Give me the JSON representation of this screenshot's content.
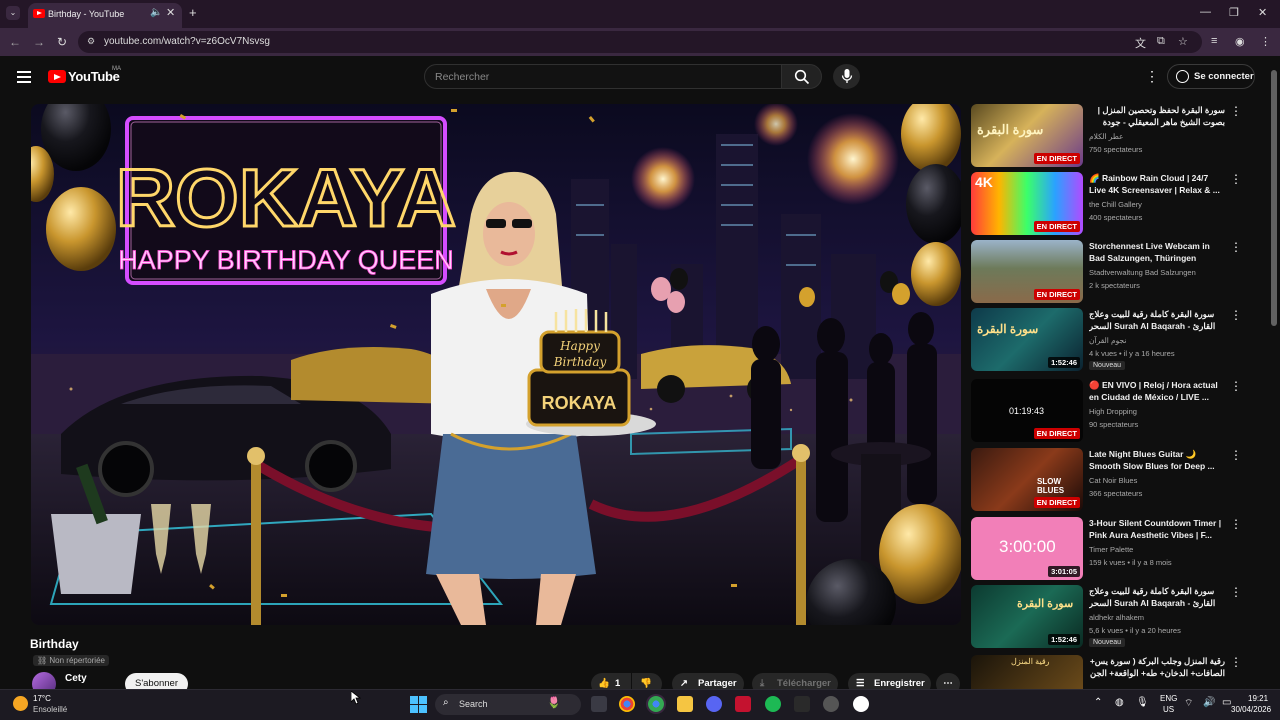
{
  "browser": {
    "tab_title": "Birthday - YouTube",
    "url": "youtube.com/watch?v=z6OcV7Nsvsg"
  },
  "youtube": {
    "logo_text": "YouTube",
    "country_code": "MA",
    "search_placeholder": "Rechercher",
    "signin_label": "Se connecter"
  },
  "video": {
    "neon_name": "ROKAYA",
    "neon_sub": "HAPPY BIRTHDAY QUEEN",
    "cake_line1": "Happy",
    "cake_line2": "Birthday",
    "cake_name": "ROKAYA",
    "title": "Birthday",
    "visibility": "Non répertoriée",
    "channel": "Cety",
    "subscribe_label": "S'abonner",
    "likes": "1",
    "share_label": "Partager",
    "download_label": "Télécharger",
    "save_label": "Enregistrer"
  },
  "recommendations": [
    {
      "title": "سورة البقرة لحفظ وتحصين المنزل | بصوت الشيخ ماهر المعيقلي - جودة عالية",
      "channel": "عطر الكلام",
      "meta": "750 spectateurs",
      "live": "EN DIRECT",
      "thumb_text": "سورة البقرة"
    },
    {
      "title": "🌈 Rainbow Rain Cloud | 24/7 Live 4K Screensaver | Relax & ...",
      "channel": "the Chill Gallery",
      "meta": "400 spectateurs",
      "live": "EN DIRECT",
      "thumb_text": "4K"
    },
    {
      "title": "Storchennest Live Webcam in Bad Salzungen, Thüringen",
      "channel": "Stadtverwaltung Bad Salzungen",
      "meta": "2 k spectateurs",
      "live": "EN DIRECT"
    },
    {
      "title": "سورة البقرة كاملة رقية للبيت وعلاج السحر Surah Al Baqarah - القارئ علاء عقل |",
      "channel": "نجوم القرآن",
      "meta": "4 k vues • il y a 16 heures",
      "duration": "1:52:46",
      "badge": "Nouveau",
      "thumb_text": "سورة البقرة"
    },
    {
      "title": "🔴 EN VIVO | Reloj / Hora actual en Ciudad de México / LIVE ...",
      "channel": "High Dropping",
      "meta": "90 spectateurs",
      "live": "EN DIRECT",
      "thumb_text": "01:19:43"
    },
    {
      "title": "Late Night Blues Guitar 🌙 Smooth Slow Blues for Deep ...",
      "channel": "Cat Noir Blues",
      "meta": "366 spectateurs",
      "live": "EN DIRECT",
      "thumb_text": "SLOW BLUES"
    },
    {
      "title": "3-Hour Silent Countdown Timer | Pink Aura Aesthetic Vibes | F...",
      "channel": "Timer Palette",
      "meta": "159 k vues • il y a 8 mois",
      "duration": "3:01:05",
      "thumb_text": "3:00:00"
    },
    {
      "title": "سورة البقرة كاملة رقية للبيت وعلاج السحر Surah Al Baqarah - القارئ علاء عقل |",
      "channel": "aldhekr alhakem",
      "meta": "5,6 k vues • il y a 20 heures",
      "duration": "1:52:46",
      "badge": "Nouveau",
      "thumb_text": "سورة البقرة"
    },
    {
      "title": "رقية المنزل وجلب البركة ( سورة يس+ الصافات+ الدخان+ طه+ الواقعة+ الجن",
      "thumb_text": "رقية المنزل"
    }
  ],
  "taskbar": {
    "temperature": "17°C",
    "weather": "Ensoleillé",
    "search_label": "Search",
    "lang1": "ENG",
    "lang2": "US",
    "time": "19:21",
    "date": "30/04/2026"
  },
  "colors": {
    "youtube_red": "#ff0000",
    "live_red": "#cc0000",
    "neon_pink": "#ff4fd8",
    "neon_gold": "#ffd76a"
  }
}
